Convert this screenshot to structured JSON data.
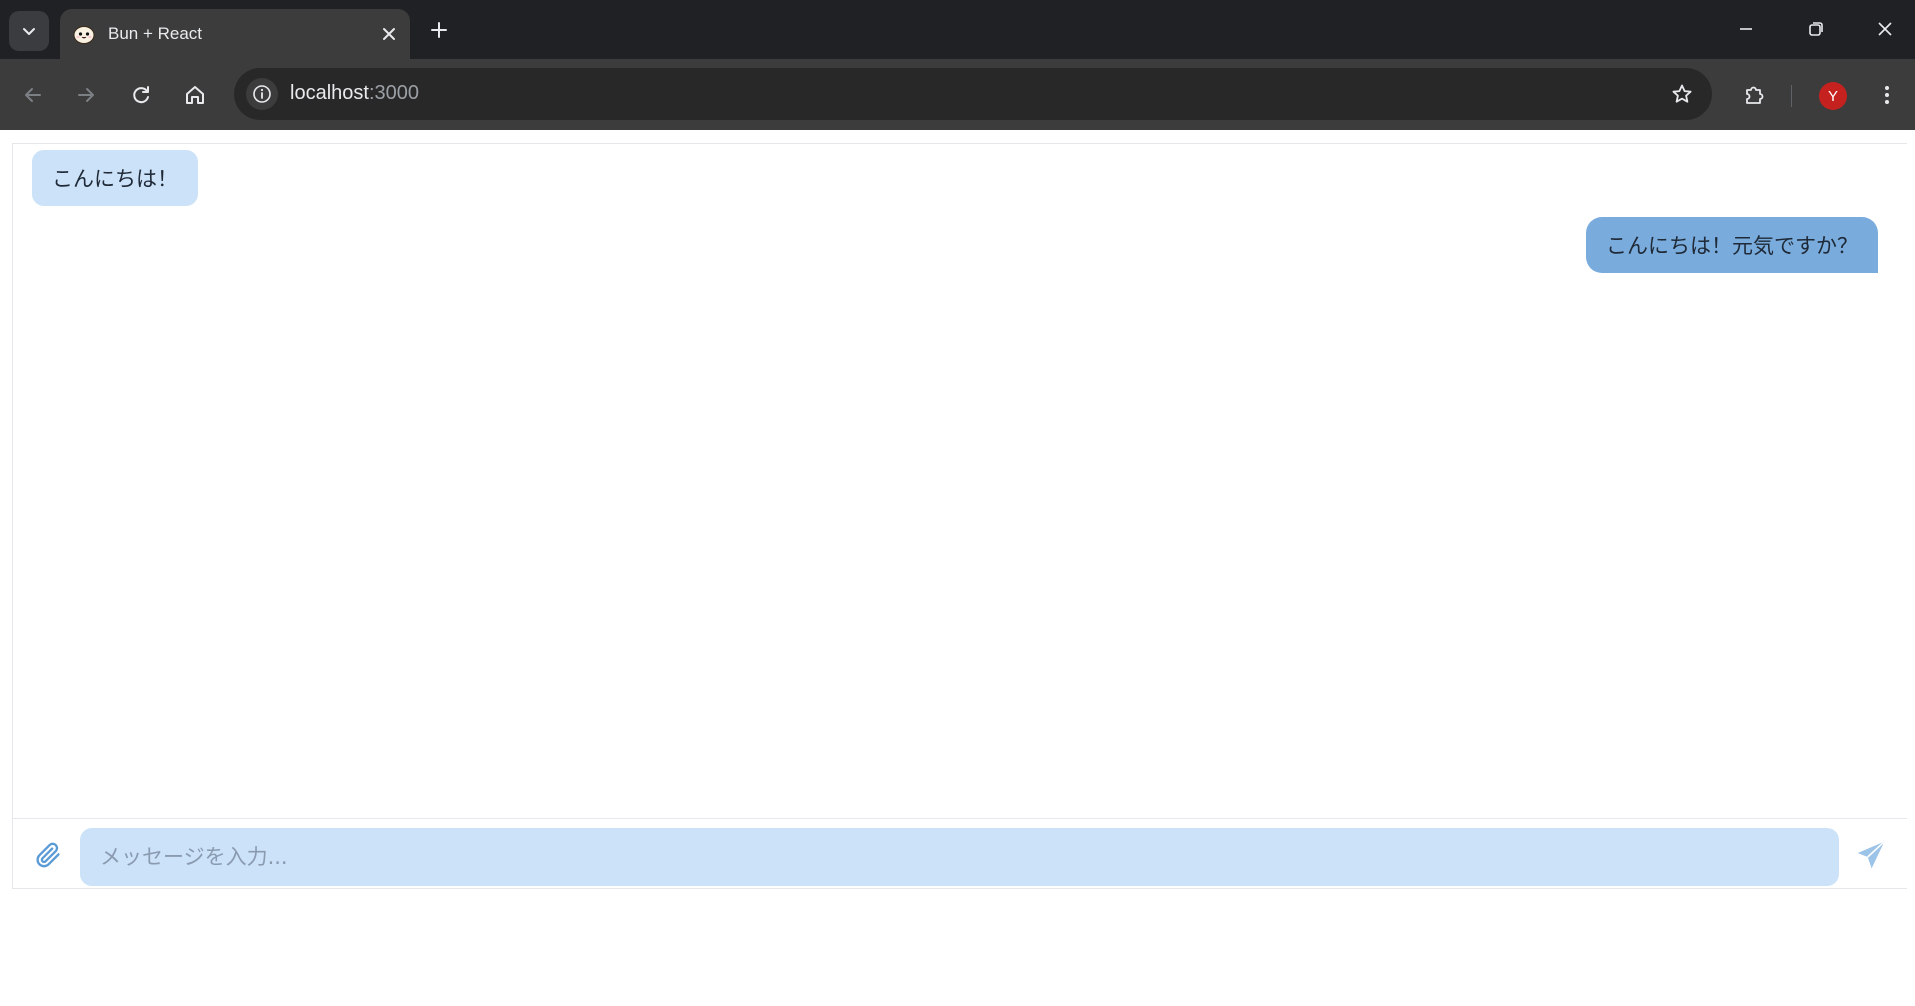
{
  "browser": {
    "tab_title": "Bun + React",
    "url_host": "localhost",
    "url_port": ":3000",
    "profile_initial": "Y"
  },
  "chat": {
    "messages": [
      {
        "sender": "other",
        "text": "こんにちは！"
      },
      {
        "sender": "me",
        "text": "こんにちは！元気ですか？"
      }
    ],
    "input_placeholder": "メッセージを入力...",
    "input_value": ""
  },
  "colors": {
    "chrome_dark": "#202124",
    "toolbar": "#3c3c3c",
    "bubble_other": "#cce2f8",
    "bubble_me": "#79acdc",
    "input_bg": "#cce2f8",
    "send_icon": "#9cc3e8",
    "avatar": "#c5221f"
  },
  "icons": {
    "tab_search": "chevron-down-icon",
    "favicon": "bun-logo-icon",
    "attach": "paperclip-icon",
    "send": "paper-plane-icon"
  }
}
